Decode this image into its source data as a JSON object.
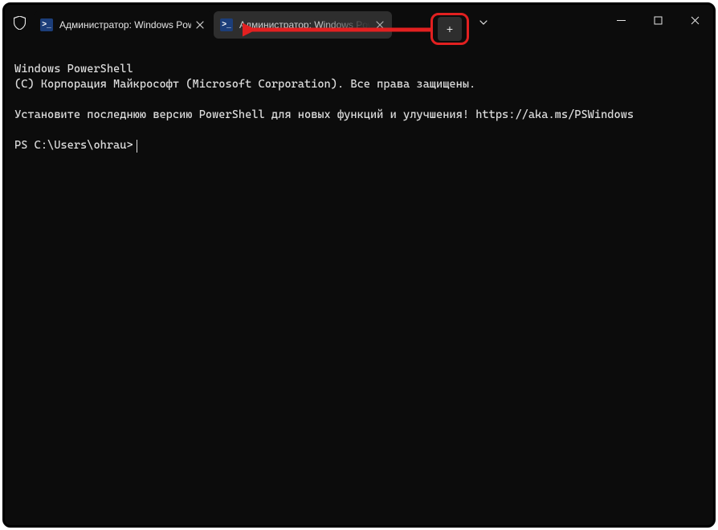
{
  "titlebar": {
    "tabs": [
      {
        "title": "Администратор: Windows PowerShell"
      },
      {
        "title": "Администратор: Windows PowerShell"
      }
    ],
    "new_tab_label": "+",
    "chev_label": "⌄"
  },
  "terminal": {
    "line1": "Windows PowerShell",
    "line2": "(C) Корпорация Майкрософт (Microsoft Corporation). Все права защищены.",
    "line3": "Установите последнюю версию PowerShell для новых функций и улучшения! https://aka.ms/PSWindows",
    "prompt": "PS C:\\Users\\ohrau>"
  }
}
